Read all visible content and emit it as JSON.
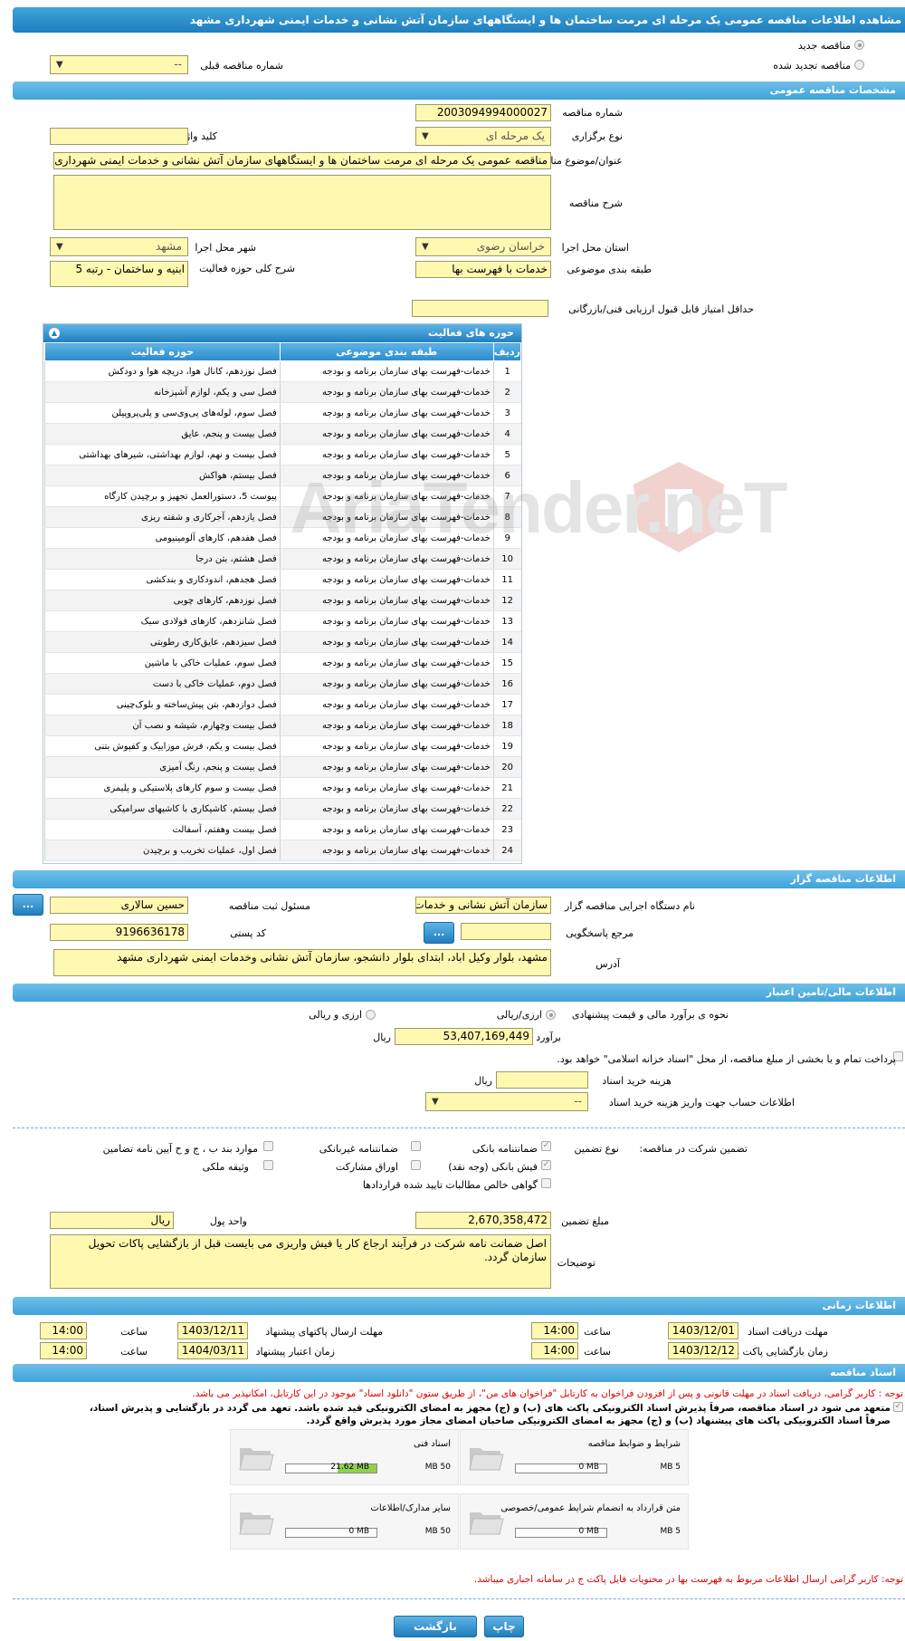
{
  "header": {
    "title": "مشاهده اطلاعات مناقصه عمومی یک مرحله ای مرمت ساختمان ها و ایستگاههای سازمان آتش نشانی و خدمات ایمنی شهرداری مشهد"
  },
  "top": {
    "new_label": "مناقصه جدید",
    "renew_label": "مناقصه تجدید شده",
    "prev_label": "شماره مناقصه قبلی",
    "prev_value": "--"
  },
  "general": {
    "section": "مشخصات مناقصه عمومی",
    "number_label": "شماره مناقصه",
    "number": "2003094994000027",
    "type_label": "نوع برگزاری",
    "type": "یک مرحله ای",
    "keyword_label": "کلید واژه",
    "keyword": "",
    "subject_label": "عنوان/موضوع مناقصه",
    "subject": "مناقصه عمومی یک مرحله ای مرمت ساختمان ها و ایستگاههای سازمان آتش نشانی و خدمات ایمنی شهرداری مشهد",
    "desc_label": "شرح مناقصه",
    "desc": "",
    "province_label": "استان محل اجرا",
    "province": "خراسان رضوی",
    "city_label": "شهر محل اجرا",
    "city": "مشهد",
    "category_label": "طبقه بندی موضوعی",
    "category": "خدمات با فهرست بها",
    "scope_label": "شرح کلی حوزه فعالیت",
    "scope": "ابنیه و ساختمان - رتبه 5",
    "minscore_label": "حداقل امتیاز قابل قبول ارزیابی فنی/بازرگانی",
    "minscore": ""
  },
  "activities": {
    "title": "حوزه های فعالیت",
    "col_row": "ردیف",
    "col_class": "طبقه بندی موضوعی",
    "col_act": "حوزه فعالیت",
    "rows": [
      [
        "1",
        "خدمات-فهرست بهای سازمان برنامه و بودجه",
        "فصل نوزدهم، کانال هوا، دریچه هوا و دودکش"
      ],
      [
        "2",
        "خدمات-فهرست بهای سازمان برنامه و بودجه",
        "فصل سی و یکم، لوازم آشپزخانه"
      ],
      [
        "3",
        "خدمات-فهرست بهای سازمان برنامه و بودجه",
        "فصل سوم، لوله‌های پی‌وی‌سی و پلی‌پروپیلن"
      ],
      [
        "4",
        "خدمات-فهرست بهای سازمان برنامه و بودجه",
        "فصل بیست و پنجم، عایق"
      ],
      [
        "5",
        "خدمات-فهرست بهای سازمان برنامه و بودجه",
        "فصل بیست و نهم، لوازم بهداشتی، شیرهای بهداشتی"
      ],
      [
        "6",
        "خدمات-فهرست بهای سازمان برنامه و بودجه",
        "فصل بیستم، هواکش"
      ],
      [
        "7",
        "خدمات-فهرست بهای سازمان برنامه و بودجه",
        "پیوست 5، دستورالعمل تجهیز و برچیدن کارگاه"
      ],
      [
        "8",
        "خدمات-فهرست بهای سازمان برنامه و بودجه",
        "فصل یازدهم، آجرکاری و شفته ریزی"
      ],
      [
        "9",
        "خدمات-فهرست بهای سازمان برنامه و بودجه",
        "فصل هفدهم، کارهای آلومینیومی"
      ],
      [
        "10",
        "خدمات-فهرست بهای سازمان برنامه و بودجه",
        "فصل هشتم، بتن درجا"
      ],
      [
        "11",
        "خدمات-فهرست بهای سازمان برنامه و بودجه",
        "فصل هجدهم، اندودکاری و بندکشی"
      ],
      [
        "12",
        "خدمات-فهرست بهای سازمان برنامه و بودجه",
        "فصل نوزدهم، کارهای چوبی"
      ],
      [
        "13",
        "خدمات-فهرست بهای سازمان برنامه و بودجه",
        "فصل شانزدهم، کارهای فولادی سبک"
      ],
      [
        "14",
        "خدمات-فهرست بهای سازمان برنامه و بودجه",
        "فصل سیزدهم، عایق‌کاری رطوبتی"
      ],
      [
        "15",
        "خدمات-فهرست بهای سازمان برنامه و بودجه",
        "فصل سوم، عملیات خاکی با ماشین"
      ],
      [
        "16",
        "خدمات-فهرست بهای سازمان برنامه و بودجه",
        "فصل دوم، عملیات خاکی با دست"
      ],
      [
        "17",
        "خدمات-فهرست بهای سازمان برنامه و بودجه",
        "فصل دوازدهم، بتن پیش‌ساخته و بلوک‌چینی"
      ],
      [
        "18",
        "خدمات-فهرست بهای سازمان برنامه و بودجه",
        "فصل بیست وچهارم، شیشه و نصب آن"
      ],
      [
        "19",
        "خدمات-فهرست بهای سازمان برنامه و بودجه",
        "فصل بیست و یکم، فرش موزاییک و کفپوش بتنی"
      ],
      [
        "20",
        "خدمات-فهرست بهای سازمان برنامه و بودجه",
        "فصل بیست و پنجم، رنگ آمیزی"
      ],
      [
        "21",
        "خدمات-فهرست بهای سازمان برنامه و بودجه",
        "فصل بیست و سوم کارهای پلاستیکی و پلیمری"
      ],
      [
        "22",
        "خدمات-فهرست بهای سازمان برنامه و بودجه",
        "فصل بیستم، کاشیکاری با کاشیهای سرامیکی"
      ],
      [
        "23",
        "خدمات-فهرست بهای سازمان برنامه و بودجه",
        "فصل بیست وهفتم، آسفالت"
      ],
      [
        "24",
        "خدمات-فهرست بهای سازمان برنامه و بودجه",
        "فصل اول، عملیات تخریب و برچیدن"
      ]
    ]
  },
  "organizer": {
    "section": "اطلاعات مناقصه گزار",
    "org_label": "نام دستگاه اجرایی مناقصه گزار",
    "org": "سازمان آتش نشانی و خدمات ایمنی",
    "resp_label": "مسئول ثبت مناقصه",
    "resp": "حسین سالاری",
    "ref_label": "مرجع پاسخگویی",
    "ref": "",
    "postal_label": "کد پستی",
    "postal": "9196636178",
    "addr_label": "آدرس",
    "addr": "مشهد، بلوار وکیل اباد، ابتدای بلوار دانشجو، سازمان آتش نشانی وخدمات ایمنی شهرداری مشهد",
    "more_btn": "..."
  },
  "finance": {
    "section": "اطلاعات مالی/تامین اعتبار",
    "method_label": "نحوه ی برآورد مالی و قیمت پیشنهادی",
    "opt1": "ارزی/ریالی",
    "opt2": "ارزی و ریالی",
    "estimate_label": "برآورد مالی",
    "estimate": "53,407,169,449",
    "unit": "ریال",
    "treasury": "پرداخت تمام و یا بخشی از مبلغ مناقصه، از محل \"اسناد خزانه اسلامی\" خواهد بود.",
    "doc_fee_label": "هزینه خرید اسناد",
    "doc_fee": "",
    "doc_fee_unit": "ریال",
    "account_label": "اطلاعات حساب جهت واریز هزینه خرید اسناد",
    "account": "--"
  },
  "guarantee": {
    "title": "تضمین شرکت در مناقصه:",
    "type_label": "نوع تضمین",
    "items": [
      "ضمانتنامه بانکی",
      "ضمانتنامه غیربانکی",
      "موارد بند ب ، ج و ح آیین نامه تضامین",
      "فیش بانکی (وجه نقد)",
      "اوراق مشارکت",
      "وثیقه ملکی",
      "گواهی خالص مطالبات تایید شده قراردادها"
    ],
    "amount_label": "مبلغ تضمین",
    "amount": "2,670,358,472",
    "currency_label": "واحد پول",
    "currency": "ریال",
    "notes_label": "توضیحات",
    "notes": "اصل ضمانت نامه شرکت در فرآیند ارجاع کار یا فیش واریزی می بایست قبل از بازگشایی پاکات تحویل سازمان گردد."
  },
  "timing": {
    "section": "اطلاعات زمانی",
    "recv_label": "مهلت دریافت اسناد",
    "recv": "1403/12/01",
    "recv_time": "14:00",
    "send_label": "مهلت ارسال پاکتهای پیشنهاد",
    "send": "1403/12/11",
    "send_time": "14:00",
    "open_label": "زمان بازگشایی پاکت ها",
    "open": "1403/12/12",
    "open_time": "14:00",
    "valid_label": "زمان اعتبار پیشنهاد",
    "valid": "1404/03/11",
    "valid_time": "14:00",
    "time_label": "ساعت"
  },
  "docs": {
    "section": "اسناد مناقصه",
    "notice": "توجه : کاربر گرامی، دریافت اسناد در مهلت قانونی و پس از افزودن فراخوان به کارتابل \"فراخوان های من\"، از طریق ستون \"دانلود اسناد\" موجود در این کارتابل، امکانپذیر می باشد.",
    "commit1": "متعهد می شود در اسناد مناقصه، صرفاً پذیرش اسناد الکترونیکی پاکت های (ب) و (ج) مجهز به امضای الکترونیکی قید شده باشد. تعهد می گردد در بازگشایی و پذیرش اسناد،",
    "commit2": "صرفاً اسناد الکترونیکی پاکت های پیشنهاد (ب) و (ج) مجهز به امضای الکترونیکی صاحبان امضای مجاز مورد پذیرش واقع گردد.",
    "files": [
      {
        "name": "شرایط و ضوابط مناقصه",
        "used": "0 MB",
        "max": "5 MB",
        "fill": 0
      },
      {
        "name": "اسناد فنی",
        "used": "21.62 MB",
        "max": "50 MB",
        "fill": 0.43
      },
      {
        "name": "متن قرارداد به انضمام شرایط عمومی/خصوصی",
        "used": "0 MB",
        "max": "5 MB",
        "fill": 0
      },
      {
        "name": "سایر مدارک/اطلاعات",
        "used": "0 MB",
        "max": "50 MB",
        "fill": 0
      }
    ],
    "note2": "توجه: کاربر گرامی ارسال اطلاعات مربوط به فهرست بها در محتویات فایل پاکت ج در سامانه اجباری میباشد."
  },
  "footer": {
    "back": "بازگشت",
    "print": "چاپ"
  },
  "watermark": "AriaTender.neT"
}
